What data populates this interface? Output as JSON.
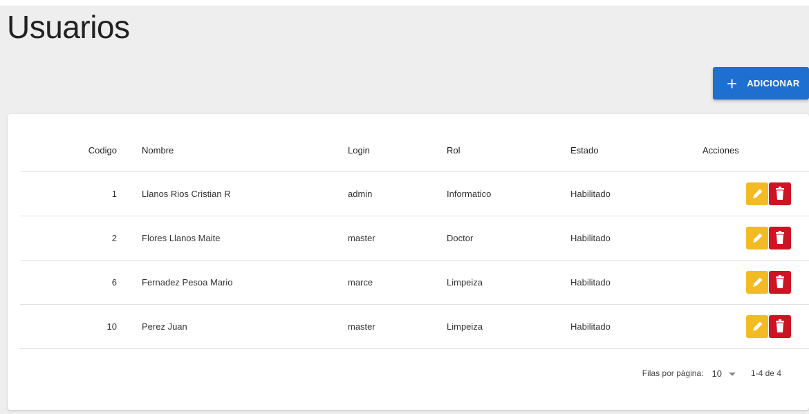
{
  "page": {
    "title": "Usuarios"
  },
  "toolbar": {
    "add_label": "ADICIONAR",
    "add_icon": "+"
  },
  "table": {
    "headers": {
      "codigo": "Codigo",
      "nombre": "Nombre",
      "login": "Login",
      "rol": "Rol",
      "estado": "Estado",
      "acciones": "Acciones"
    },
    "rows": [
      {
        "codigo": "1",
        "nombre": "Llanos Rios Cristian R",
        "login": "admin",
        "rol": "Informatico",
        "estado": "Habilitado"
      },
      {
        "codigo": "2",
        "nombre": "Flores Llanos Maite",
        "login": "master",
        "rol": "Doctor",
        "estado": "Habilitado"
      },
      {
        "codigo": "6",
        "nombre": "Fernadez Pesoa Mario",
        "login": "marce",
        "rol": "Limpeiza",
        "estado": "Habilitado"
      },
      {
        "codigo": "10",
        "nombre": "Perez Juan",
        "login": "master",
        "rol": "Limpeiza",
        "estado": "Habilitado"
      }
    ]
  },
  "pagination": {
    "rows_per_page_label": "Filas por página:",
    "rows_per_page_value": "10",
    "range_text": "1-4 de 4"
  },
  "colors": {
    "primary": "#1f6fd1",
    "edit": "#f2bb23",
    "delete": "#cf1322"
  }
}
